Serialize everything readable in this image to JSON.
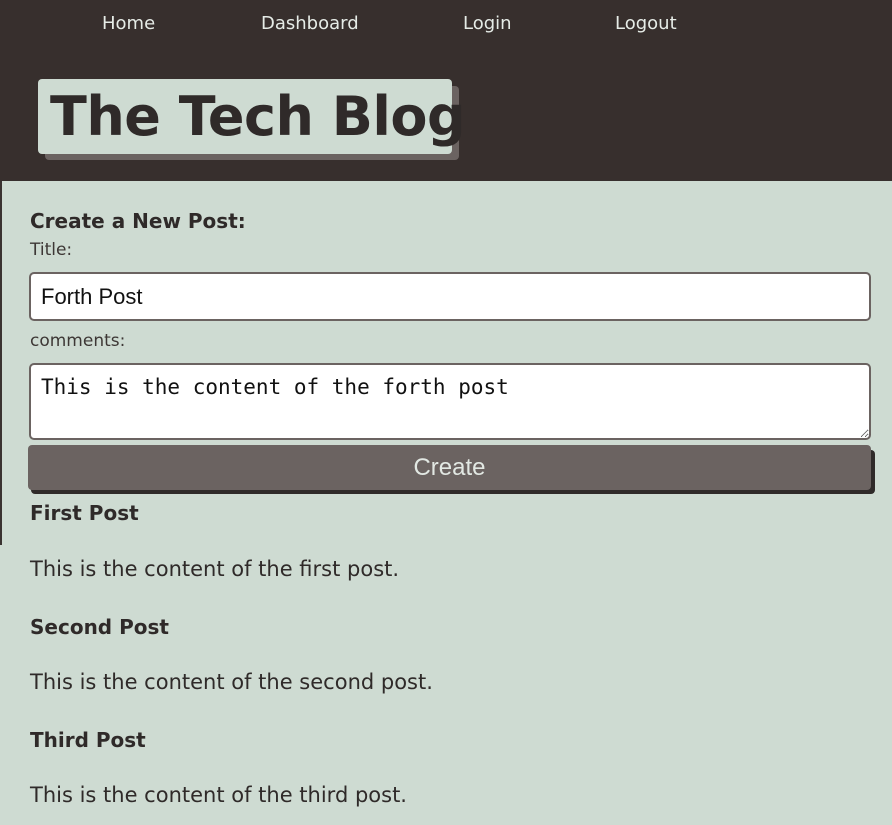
{
  "nav": {
    "home": "Home",
    "dashboard": "Dashboard",
    "login": "Login",
    "logout": "Logout"
  },
  "header": {
    "title": "The Tech Blog"
  },
  "form": {
    "heading": "Create a New Post:",
    "title_label": "Title:",
    "title_value": "Forth Post",
    "comments_label": "comments:",
    "comments_value": "This is the content of the forth post",
    "submit_label": "Create"
  },
  "posts": [
    {
      "title": "First Post",
      "content": "This is the content of the first post."
    },
    {
      "title": "Second Post",
      "content": "This is the content of the second post."
    },
    {
      "title": "Third Post",
      "content": "This is the content of the third post."
    }
  ],
  "colors": {
    "header_bg": "#372f2d",
    "page_bg": "#cedbd2",
    "button_bg": "#6b6361",
    "text": "#2f2a29"
  }
}
